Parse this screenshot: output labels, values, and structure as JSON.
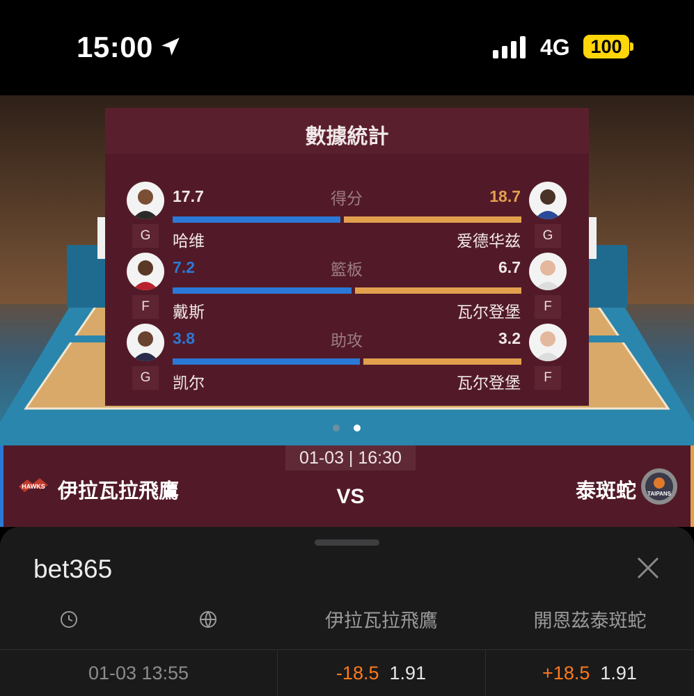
{
  "status_bar": {
    "time": "15:00",
    "network": "4G",
    "battery": "100"
  },
  "stats": {
    "title": "數據統計",
    "rows": [
      {
        "category": "得分",
        "left_value": "17.7",
        "right_value": "18.7",
        "left_share": 0.486,
        "leader": "right",
        "left_player": {
          "name": "哈维",
          "position": "G"
        },
        "right_player": {
          "name": "爱德华兹",
          "position": "G"
        }
      },
      {
        "category": "籃板",
        "left_value": "7.2",
        "right_value": "6.7",
        "left_share": 0.518,
        "leader": "left",
        "left_player": {
          "name": "戴斯",
          "position": "F"
        },
        "right_player": {
          "name": "瓦尔登堡",
          "position": "F"
        }
      },
      {
        "category": "助攻",
        "left_value": "3.8",
        "right_value": "3.2",
        "left_share": 0.543,
        "leader": "left",
        "left_player": {
          "name": "凯尔",
          "position": "G"
        },
        "right_player": {
          "name": "瓦尔登堡",
          "position": "F"
        }
      }
    ],
    "colors": {
      "home": "#2b79d6",
      "away": "#e2a04e"
    }
  },
  "carousel": {
    "pages": 2,
    "active": 1
  },
  "match": {
    "datetime": "01-03 | 16:30",
    "home_team": "伊拉瓦拉飛鷹",
    "home_logo_text": "HAWKS",
    "vs": "VS",
    "away_team": "泰斑蛇",
    "away_logo_text": "TAIPANS"
  },
  "odds_sheet": {
    "bookmaker": "bet365",
    "headers": {
      "clock_icon": "clock-icon",
      "ball_icon": "basketball-icon",
      "home": "伊拉瓦拉飛鷹",
      "away": "開恩茲泰斑蛇"
    },
    "rows": [
      {
        "time": "01-03 13:55",
        "home_handicap": "-18.5",
        "home_odds": "1.91",
        "away_handicap": "+18.5",
        "away_odds": "1.91"
      }
    ],
    "handicap_color": "#ff7a1a"
  }
}
